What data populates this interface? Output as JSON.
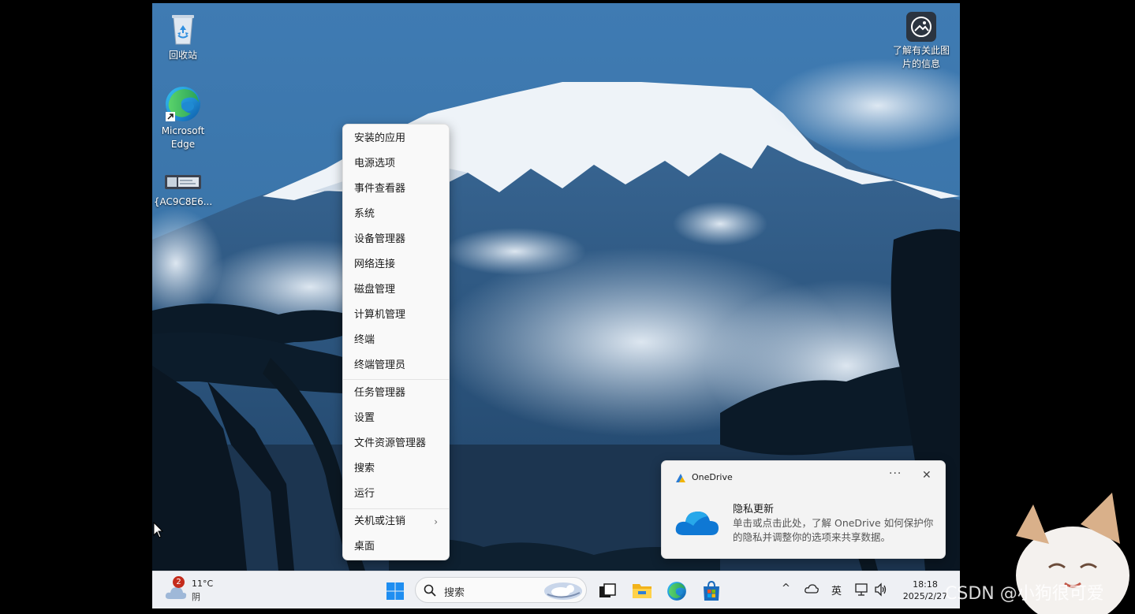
{
  "desktop": {
    "icons": [
      {
        "label": "回收站",
        "icon": "recycle-bin-icon"
      },
      {
        "label": "Microsoft Edge",
        "icon": "edge-icon"
      },
      {
        "label": "{AC9C8E6...",
        "icon": "shortcut-file-icon"
      }
    ],
    "spotlight": {
      "label": "了解有关此图片的信息",
      "icon": "spotlight-info-icon"
    }
  },
  "context_menu": {
    "group1": [
      "安装的应用",
      "电源选项",
      "事件查看器",
      "系统",
      "设备管理器",
      "网络连接",
      "磁盘管理",
      "计算机管理",
      "终端",
      "终端管理员"
    ],
    "group2": [
      "任务管理器",
      "设置",
      "文件资源管理器",
      "搜索",
      "运行"
    ],
    "group3": [
      "关机或注销",
      "桌面"
    ],
    "submenu_chevron": "›"
  },
  "toast": {
    "app": "OneDrive",
    "more": "···",
    "close": "✕",
    "title": "隐私更新",
    "body": "单击或点击此处，了解 OneDrive 如何保护你的隐私并调整你的选项来共享数据。"
  },
  "taskbar": {
    "weather": {
      "badge": "2",
      "temp": "11°C",
      "condition": "阴",
      "icon": "cloud-weather-icon"
    },
    "search_placeholder": "搜索",
    "pinned": [
      "start-icon",
      "task-view-icon",
      "file-explorer-icon",
      "edge-icon",
      "store-icon"
    ],
    "tray": {
      "chevron": "^",
      "ime": "英"
    },
    "clock": {
      "time": "18:18",
      "date": "2025/2/27"
    }
  },
  "watermark": "CSDN @小狗很可爱"
}
